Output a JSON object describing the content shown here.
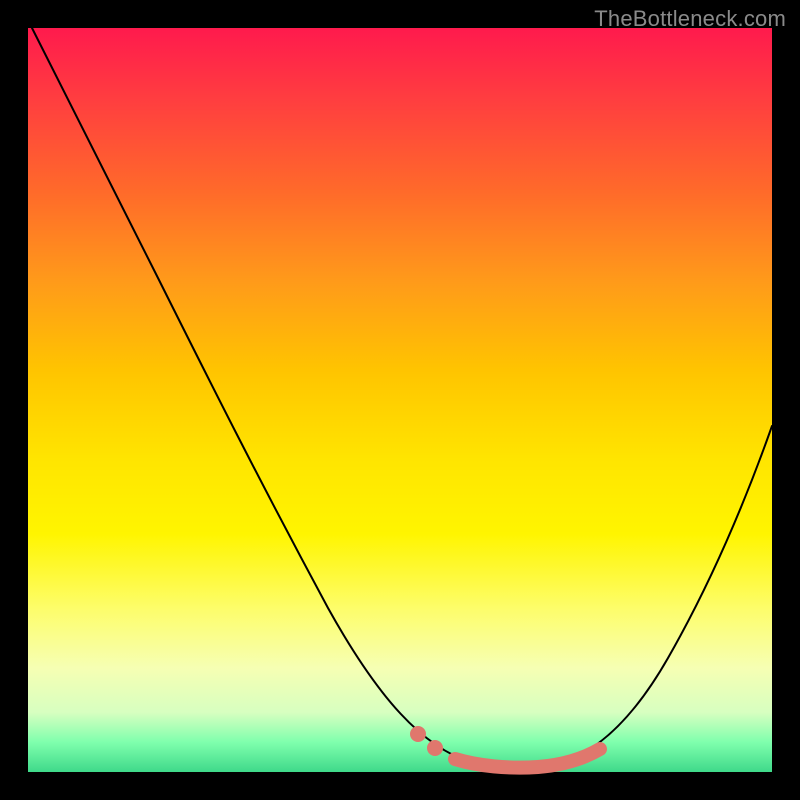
{
  "watermark": "TheBottleneck.com",
  "chart_data": {
    "type": "line",
    "title": "",
    "xlabel": "",
    "ylabel": "",
    "xlim": [
      0,
      100
    ],
    "ylim": [
      0,
      100
    ],
    "grid": false,
    "legend": false,
    "background": "red-yellow-green vertical gradient",
    "series": [
      {
        "name": "bottleneck-curve",
        "x": [
          0,
          5,
          10,
          15,
          20,
          25,
          30,
          35,
          40,
          45,
          50,
          53,
          56,
          60,
          64,
          68,
          72,
          76,
          80,
          84,
          88,
          92,
          96,
          100
        ],
        "y": [
          100,
          92,
          84,
          76,
          68,
          59,
          50,
          41,
          32,
          23,
          14,
          8,
          4,
          1,
          0,
          0,
          0,
          1,
          4,
          10,
          19,
          29,
          40,
          52
        ]
      }
    ],
    "highlight": {
      "name": "optimal-range",
      "color": "#e0776d",
      "dots_x": [
        53,
        56
      ],
      "segment_x": [
        60,
        78
      ],
      "y_at_dots": [
        8,
        4
      ],
      "y_at_segment": [
        1,
        0,
        0,
        0,
        1,
        2
      ]
    },
    "note": "y is plotted downward from top; optimal (green) zone at bottom where curve reaches minimum"
  }
}
